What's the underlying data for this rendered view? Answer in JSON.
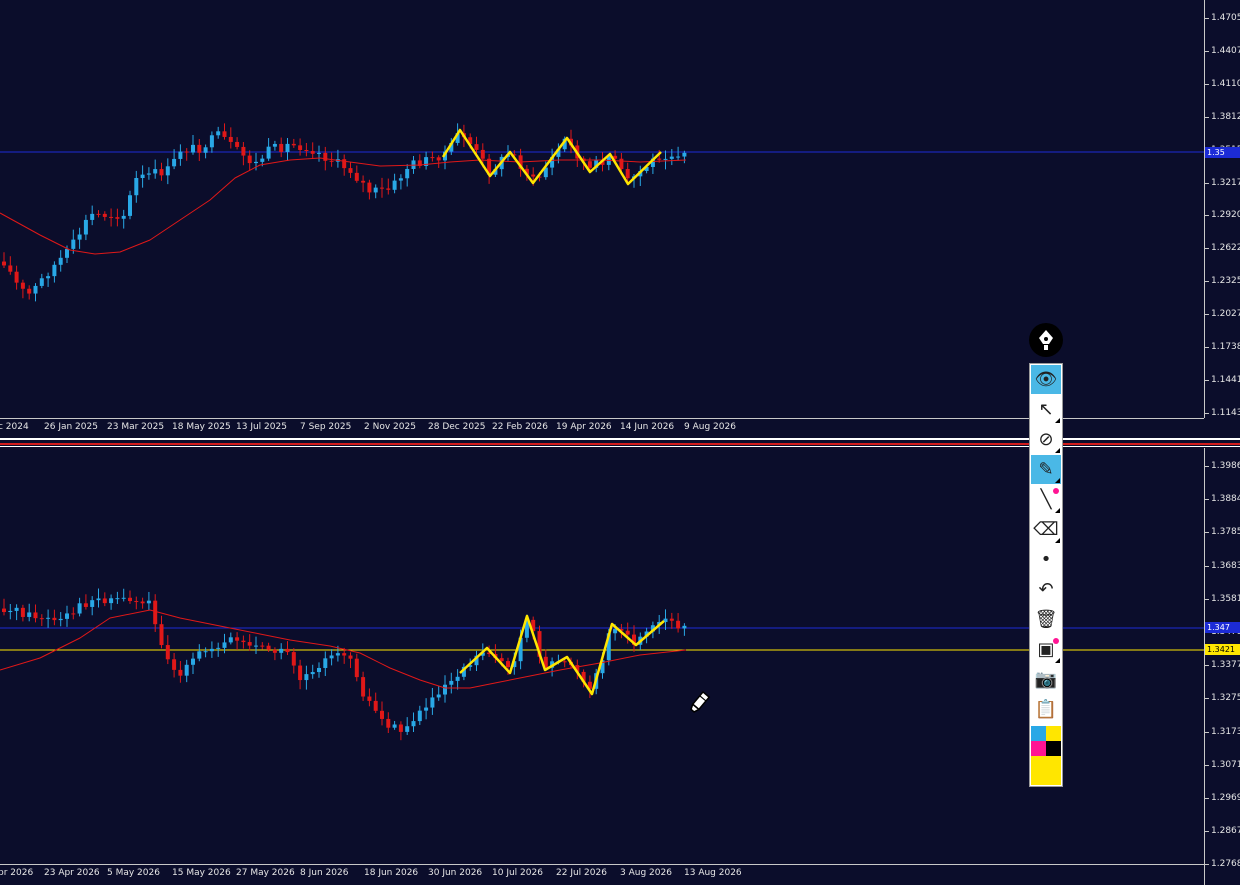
{
  "colors": {
    "background": "#0b0d2b",
    "bull_candle": "#29a8e6",
    "bear_candle": "#e01818",
    "moving_average": "#e01818",
    "zigzag": "#ffe600",
    "price_line": "#1c2bd6",
    "horizontal_line": "#ffe600",
    "axis_text": "#e6e6e6"
  },
  "top_chart": {
    "price_axis": [
      "1.47052",
      "1.44077",
      "1.41102",
      "1.38127",
      "1.35152",
      "1.32177",
      "1.29202",
      "1.26227",
      "1.23252",
      "1.20277",
      "1.17387",
      "1.14412",
      "1.11437"
    ],
    "time_axis": [
      "c 2024",
      "26 Jan 2025",
      "23 Mar 2025",
      "18 May 2025",
      "13 Jul 2025",
      "7 Sep 2025",
      "2 Nov 2025",
      "28 Dec 2025",
      "22 Feb 2026",
      "19 Apr 2026",
      "14 Jun 2026",
      "9 Aug 2026"
    ],
    "current_price_tag": "1.35"
  },
  "bottom_chart": {
    "price_axis": [
      "1.39869",
      "1.38849",
      "1.37859",
      "1.36839",
      "1.35819",
      "1.34799",
      "1.33779",
      "1.32759",
      "1.31739",
      "1.30719",
      "1.29699",
      "1.28679",
      "1.27689"
    ],
    "time_axis": [
      "pr 2026",
      "23 Apr 2026",
      "5 May 2026",
      "15 May 2026",
      "27 May 2026",
      "8 Jun 2026",
      "18 Jun 2026",
      "30 Jun 2026",
      "10 Jul 2026",
      "22 Jul 2026",
      "3 Aug 2026",
      "13 Aug 2026"
    ],
    "current_price_tag": "1.347",
    "line_price_tag": "1.3421"
  },
  "toolbar": {
    "header_icon": "fountain-pen-icon",
    "tools": [
      {
        "name": "eye-icon",
        "glyph": "👁",
        "active": true
      },
      {
        "name": "cursor-arrow-icon",
        "glyph": "↖",
        "active": false
      },
      {
        "name": "crossed-circle-icon",
        "glyph": "⊘",
        "active": false
      },
      {
        "name": "highlighter-icon",
        "glyph": "✎",
        "active": true
      },
      {
        "name": "line-pen-icon",
        "glyph": "╲",
        "active": false
      },
      {
        "name": "eraser-icon",
        "glyph": "⌫",
        "active": false
      },
      {
        "name": "dot-icon",
        "glyph": "•",
        "active": false
      },
      {
        "name": "undo-icon",
        "glyph": "↶",
        "active": false
      },
      {
        "name": "trash-icon",
        "glyph": "🗑",
        "active": false
      },
      {
        "name": "presentation-board-icon",
        "glyph": "▣",
        "active": false
      },
      {
        "name": "camera-icon",
        "glyph": "📷",
        "active": false
      },
      {
        "name": "clipboard-icon",
        "glyph": "📋",
        "active": false
      }
    ],
    "swatches": [
      "#29a8e6",
      "#ffe600",
      "#ff1493",
      "#000000",
      "#ffe600"
    ]
  }
}
